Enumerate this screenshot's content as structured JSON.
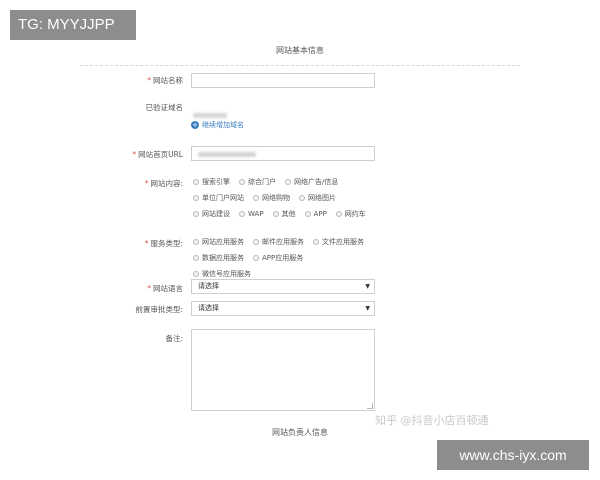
{
  "badge_left": "TG: MYYJJPP",
  "badge_right": "www.chs-iyx.com",
  "watermark": "知乎 @抖音小店百顿通",
  "section_title": "网站基本信息",
  "section_title_bottom": "网站负责人信息",
  "required_mark": "*",
  "fields": {
    "site_name": {
      "label": "网站名称",
      "value": ""
    },
    "verified_domain": {
      "label": "已验证域名",
      "add_link": "继续增加域名"
    },
    "homepage_url": {
      "label": "网站首页URL"
    },
    "site_content": {
      "label": "网站内容:",
      "options": [
        "搜索引擎",
        "综合门户",
        "网络广告/信息",
        "单位门户网站",
        "网络购物",
        "网络图片",
        "网站建设",
        "WAP",
        "其他",
        "APP",
        "网约车"
      ]
    },
    "service_type": {
      "label": "服务类型:",
      "options": [
        "网站应用服务",
        "邮件应用服务",
        "文件应用服务",
        "数据应用服务",
        "APP应用服务",
        "微信号应用服务"
      ]
    },
    "site_language": {
      "label": "网站语言",
      "value": "请选择"
    },
    "pre_approval_type": {
      "label": "前置审批类型:",
      "value": "请选择"
    },
    "remarks": {
      "label": "备注:"
    }
  },
  "icons": {
    "add": "plus-circle-icon",
    "dropdown": "caret-down-icon"
  },
  "colors": {
    "link": "#3a7fc1",
    "required": "#d9534f",
    "badge_bg": "#8d8d8d"
  }
}
